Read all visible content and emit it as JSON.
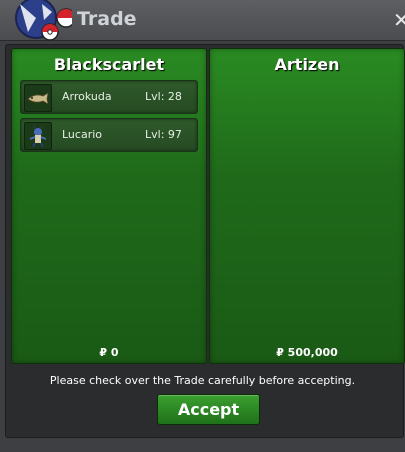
{
  "window": {
    "title": "Trade",
    "close_icon": "close-icon",
    "logo_icon": "pokeball-logo-icon"
  },
  "left_panel": {
    "trainer": "Blackscarlet",
    "pokemon": [
      {
        "name": "Arrokuda",
        "level": "Lvl: 28",
        "icon": "arrokuda-sprite-icon"
      },
      {
        "name": "Lucario",
        "level": "Lvl: 97",
        "icon": "lucario-sprite-icon"
      }
    ],
    "money": "₽ 0"
  },
  "right_panel": {
    "trainer": "Artizen",
    "pokemon": [],
    "money": "₽ 500,000"
  },
  "notice": "Please check over the Trade carefully before accepting.",
  "accept_label": "Accept",
  "colors": {
    "panel_green": "#1f6a1a",
    "button_green": "#2a8b22",
    "background": "#3e3f42"
  }
}
